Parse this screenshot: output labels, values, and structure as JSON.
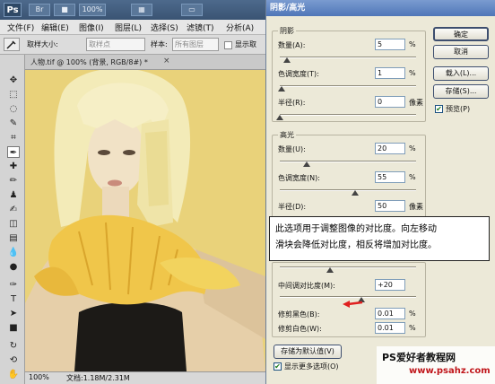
{
  "app": {
    "logo": "Ps",
    "toolbar_icons": [
      "Br",
      "■",
      "100%",
      "▦",
      "▭"
    ]
  },
  "menu": [
    "文件(F)",
    "编辑(E)",
    "图像(I)",
    "图层(L)",
    "选择(S)",
    "滤镜(T)",
    "分析(A)"
  ],
  "options": {
    "sample_size_label": "取样大小:",
    "sample_size_value": "取样点",
    "sample_label": "样本:",
    "sample_value": "所有图层",
    "show_ring_label": "显示取"
  },
  "document": {
    "tab_title": "人物.tif @ 100% (背景, RGB/8#) *",
    "zoom": "100%",
    "doc_info": "文档:1.18M/2.31M"
  },
  "dialog": {
    "title": "阴影/高光",
    "shadows": {
      "label": "阴影",
      "amount_label": "数量(A):",
      "amount_value": "5",
      "amount_unit": "%",
      "tonal_label": "色调宽度(T):",
      "tonal_value": "1",
      "tonal_unit": "%",
      "radius_label": "半径(R):",
      "radius_value": "0",
      "radius_unit": "像素"
    },
    "highlights": {
      "label": "高光",
      "amount_label": "数量(U):",
      "amount_value": "20",
      "amount_unit": "%",
      "tonal_label": "色调宽度(N):",
      "tonal_value": "55",
      "tonal_unit": "%",
      "radius_label": "半径(D):",
      "radius_value": "50",
      "radius_unit": "像素"
    },
    "adjustments": {
      "midtone_label": "中间调对比度(M):",
      "midtone_value": "+20",
      "black_clip_label": "修剪黑色(B):",
      "black_clip_value": "0.01",
      "black_clip_unit": "%",
      "white_clip_label": "修剪白色(W):",
      "white_clip_value": "0.01",
      "white_clip_unit": "%"
    },
    "buttons": {
      "ok": "确定",
      "cancel": "取消",
      "load": "载入(L)...",
      "save": "存储(S)...",
      "preview_label": "预览(P)",
      "save_default": "存储为默认值(V)",
      "more_options": "显示更多选项(O)"
    },
    "slider_levels": {
      "shadow_amount": 0.05,
      "shadow_tonal": 0.01,
      "shadow_radius": 0.0,
      "highlight_amount": 0.2,
      "highlight_tonal": 0.55,
      "highlight_radius": 0.5,
      "midtone": 0.6
    }
  },
  "tooltip": {
    "line1": "此选项用于调整图像的对比度。向左移动",
    "line2": "滑块会降低对比度，相反将增加对比度。"
  },
  "watermark": {
    "line1": "PS爱好者教程网",
    "line2": "www.psahz.com"
  }
}
